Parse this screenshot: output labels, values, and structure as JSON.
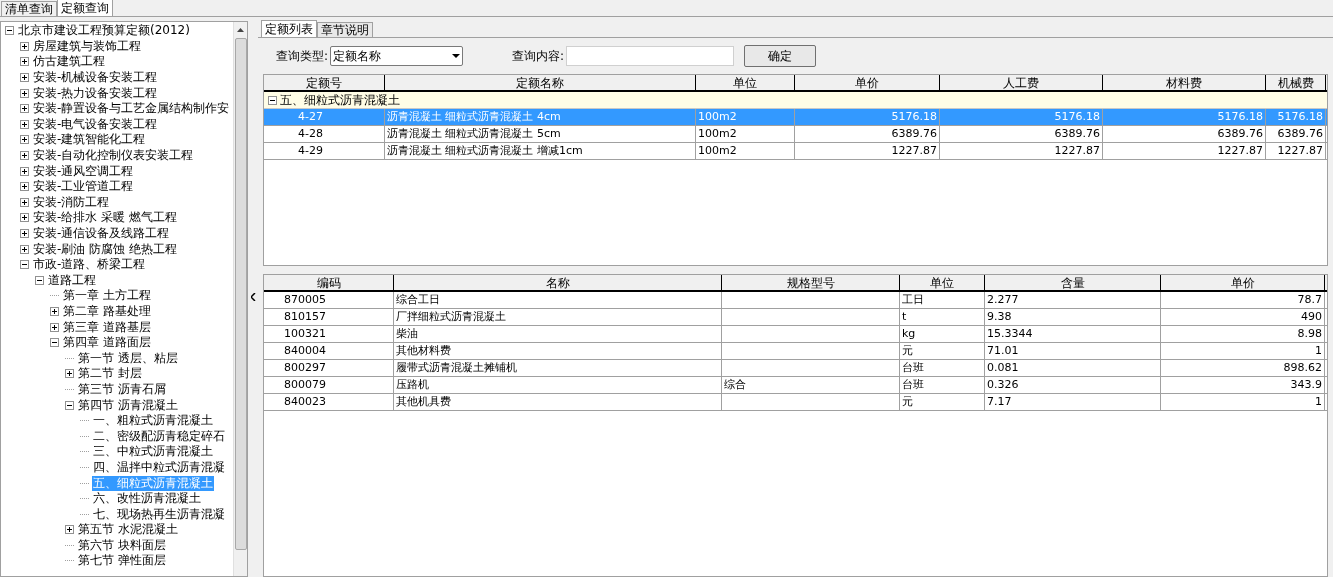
{
  "top_tabs": [
    {
      "label": "清单查询",
      "selected": false
    },
    {
      "label": "定额查询",
      "selected": true
    }
  ],
  "tree": [
    {
      "label": "北京市建设工程预算定额(2012)",
      "kind": "group",
      "expanded": true,
      "selected": false,
      "children": [
        {
          "label": "房屋建筑与装饰工程",
          "kind": "group",
          "expanded": false,
          "selected": false
        },
        {
          "label": "仿古建筑工程",
          "kind": "group",
          "expanded": false,
          "selected": false
        },
        {
          "label": "安装-机械设备安装工程",
          "kind": "group",
          "expanded": false,
          "selected": false
        },
        {
          "label": "安装-热力设备安装工程",
          "kind": "group",
          "expanded": false,
          "selected": false
        },
        {
          "label": "安装-静置设备与工艺金属结构制作安",
          "kind": "group",
          "expanded": false,
          "selected": false
        },
        {
          "label": "安装-电气设备安装工程",
          "kind": "group",
          "expanded": false,
          "selected": false
        },
        {
          "label": "安装-建筑智能化工程",
          "kind": "group",
          "expanded": false,
          "selected": false
        },
        {
          "label": "安装-自动化控制仪表安装工程",
          "kind": "group",
          "expanded": false,
          "selected": false
        },
        {
          "label": "安装-通风空调工程",
          "kind": "group",
          "expanded": false,
          "selected": false
        },
        {
          "label": "安装-工业管道工程",
          "kind": "group",
          "expanded": false,
          "selected": false
        },
        {
          "label": "安装-消防工程",
          "kind": "group",
          "expanded": false,
          "selected": false
        },
        {
          "label": "安装-给排水 采暖 燃气工程",
          "kind": "group",
          "expanded": false,
          "selected": false
        },
        {
          "label": "安装-通信设备及线路工程",
          "kind": "group",
          "expanded": false,
          "selected": false
        },
        {
          "label": "安装-刷油 防腐蚀 绝热工程",
          "kind": "group",
          "expanded": false,
          "selected": false
        },
        {
          "label": "市政-道路、桥梁工程",
          "kind": "group",
          "expanded": true,
          "selected": false,
          "children": [
            {
              "label": "道路工程",
              "kind": "group",
              "expanded": true,
              "selected": false,
              "children": [
                {
                  "label": "第一章 土方工程",
                  "kind": "leaf",
                  "selected": false
                },
                {
                  "label": "第二章 路基处理",
                  "kind": "group",
                  "expanded": false,
                  "selected": false
                },
                {
                  "label": "第三章 道路基层",
                  "kind": "group",
                  "expanded": false,
                  "selected": false
                },
                {
                  "label": "第四章 道路面层",
                  "kind": "group",
                  "expanded": true,
                  "selected": false,
                  "children": [
                    {
                      "label": "第一节 透层、粘层",
                      "kind": "leaf",
                      "selected": false
                    },
                    {
                      "label": "第二节 封层",
                      "kind": "group",
                      "expanded": false,
                      "selected": false
                    },
                    {
                      "label": "第三节 沥青石屑",
                      "kind": "leaf",
                      "selected": false
                    },
                    {
                      "label": "第四节 沥青混凝土",
                      "kind": "group",
                      "expanded": true,
                      "selected": false,
                      "children": [
                        {
                          "label": "一、粗粒式沥青混凝土",
                          "kind": "leaf",
                          "selected": false
                        },
                        {
                          "label": "二、密级配沥青稳定碎石",
                          "kind": "leaf",
                          "selected": false
                        },
                        {
                          "label": "三、中粒式沥青混凝土",
                          "kind": "leaf",
                          "selected": false
                        },
                        {
                          "label": "四、温拌中粒式沥青混凝",
                          "kind": "leaf",
                          "selected": false
                        },
                        {
                          "label": "五、细粒式沥青混凝土",
                          "kind": "leaf",
                          "selected": true
                        },
                        {
                          "label": "六、改性沥青混凝土",
                          "kind": "leaf",
                          "selected": false
                        },
                        {
                          "label": "七、现场热再生沥青混凝",
                          "kind": "leaf",
                          "selected": false
                        }
                      ]
                    },
                    {
                      "label": "第五节 水泥混凝土",
                      "kind": "group",
                      "expanded": false,
                      "selected": false
                    },
                    {
                      "label": "第六节 块料面层",
                      "kind": "leaf",
                      "selected": false
                    },
                    {
                      "label": "第七节 弹性面层",
                      "kind": "leaf",
                      "selected": false
                    }
                  ]
                }
              ]
            }
          ]
        }
      ]
    }
  ],
  "content_tabs": [
    {
      "label": "定额列表",
      "selected": true
    },
    {
      "label": "章节说明",
      "selected": false
    }
  ],
  "query": {
    "type_label": "查询类型:",
    "type_value": "定额名称",
    "content_label": "查询内容:",
    "confirm": "确定"
  },
  "quota_table": {
    "columns": [
      "定额号",
      "定额名称",
      "单位",
      "单价",
      "人工费",
      "材料费",
      "机械费"
    ],
    "groups": [
      {
        "label": "五、细粒式沥青混凝土",
        "expanded": true,
        "rows": [
          {
            "selected": true,
            "cells": [
              "4-27",
              "沥青混凝土 细粒式沥青混凝土 4cm",
              "100m2",
              "5176.18",
              "5176.18",
              "5176.18",
              "5176.18"
            ]
          },
          {
            "selected": false,
            "cells": [
              "4-28",
              "沥青混凝土 细粒式沥青混凝土 5cm",
              "100m2",
              "6389.76",
              "6389.76",
              "6389.76",
              "6389.76"
            ]
          },
          {
            "selected": false,
            "cells": [
              "4-29",
              "沥青混凝土 细粒式沥青混凝土 增减1cm",
              "100m2",
              "1227.87",
              "1227.87",
              "1227.87",
              "1227.87"
            ]
          }
        ]
      }
    ]
  },
  "resource_table": {
    "columns": [
      "编码",
      "名称",
      "规格型号",
      "单位",
      "含量",
      "单价"
    ],
    "rows": [
      [
        "870005",
        "综合工日",
        "",
        "工日",
        "2.277",
        "78.7"
      ],
      [
        "810157",
        "厂拌细粒式沥青混凝土",
        "",
        "t",
        "9.38",
        "490"
      ],
      [
        "100321",
        "柴油",
        "",
        "kg",
        "15.3344",
        "8.98"
      ],
      [
        "840004",
        "其他材料费",
        "",
        "元",
        "71.01",
        "1"
      ],
      [
        "800297",
        "履带式沥青混凝土摊铺机",
        "",
        "台班",
        "0.081",
        "898.62"
      ],
      [
        "800079",
        "压路机",
        "综合",
        "台班",
        "0.326",
        "343.9"
      ],
      [
        "840023",
        "其他机具费",
        "",
        "元",
        "7.17",
        "1"
      ]
    ]
  }
}
